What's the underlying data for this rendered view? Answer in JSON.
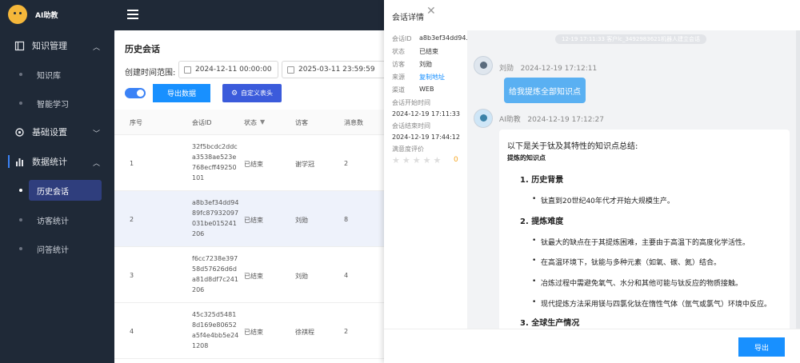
{
  "app": {
    "logo_text": "AI助教"
  },
  "sidebar": {
    "groups": [
      {
        "label": "知识管理",
        "items": [
          "知识库",
          "智能学习"
        ]
      },
      {
        "label": "基础设置"
      },
      {
        "label": "数据统计",
        "items": [
          "历史会话",
          "访客统计",
          "问答统计"
        ]
      }
    ]
  },
  "page": {
    "title": "历史会话",
    "date_label": "创建时间范围:",
    "date_start": "2024-12-11 00:00:00",
    "date_end": "2025-03-11 23:59:59",
    "export_label": "导出数据",
    "custom_header_label": "自定义表头",
    "columns": [
      "序号",
      "会话ID",
      "状态",
      "访客",
      "消息数"
    ],
    "rows": [
      {
        "index": "1",
        "id": "32f5bcdc2ddca3538ae523e768ecff49250101",
        "status": "已结束",
        "visitor": "谢学冠",
        "count": "2"
      },
      {
        "index": "2",
        "id": "a8b3ef34dd9489fc87932097031be015241206",
        "status": "已结束",
        "visitor": "刘勋",
        "count": "8"
      },
      {
        "index": "3",
        "id": "f6cc7238e39758d57626d6da81d8df7c241206",
        "status": "已结束",
        "visitor": "刘勋",
        "count": "4"
      },
      {
        "index": "4",
        "id": "45c325d54818d169e80652a5f4e4bb5e241208",
        "status": "已结束",
        "visitor": "徐祺程",
        "count": "2"
      }
    ]
  },
  "drawer": {
    "title": "会话详情",
    "meta": {
      "id_label": "会话ID",
      "id_value": "a8b3ef34dd94...",
      "status_label": "状态",
      "status_value": "已结束",
      "visitor_label": "访客",
      "visitor_value": "刘勋",
      "source_label": "来源",
      "source_value": "复制地址",
      "channel_label": "渠道",
      "channel_value": "WEB",
      "start_label": "会话开始时间",
      "start_value": "2024-12-19 17:11:33",
      "end_label": "会话结束时间",
      "end_value": "2024-12-19 17:44:12",
      "rating_label": "满意度评价",
      "rating_score": "0",
      "rating_stars": "★★★★★"
    },
    "chat": {
      "system": "12-19 17:11:33 客户lc_3492983621机器人建立会话",
      "user_name": "刘勋",
      "user_time": "2024-12-19 17:12:11",
      "user_msg": "给我提炼全部知识点",
      "ai_name": "AI助教",
      "ai_time": "2024-12-19 17:12:27",
      "ai_lines": {
        "intro": "以下是关于钛及其特性的知识点总结:",
        "sub": "提炼的知识点",
        "h1": "1. 历史背景",
        "b1": "钛直到20世纪40年代才开始大规模生产。",
        "h2": "2. 提炼难度",
        "b2": "钛最大的缺点在于其提炼困难，主要由于高温下的高度化学活性。",
        "b3": "在高温环境下，钛能与多种元素（如氧、碳、氮）结合。",
        "b4": "冶炼过程中需避免氧气、水分和其他可能与钛反应的物质接触。",
        "b5": "现代提炼方法采用镁与四氯化钛在惰性气体（氩气或氯气）环境中反应。",
        "h3": "3. 全球生产情况"
      }
    },
    "export_label": "导出"
  }
}
